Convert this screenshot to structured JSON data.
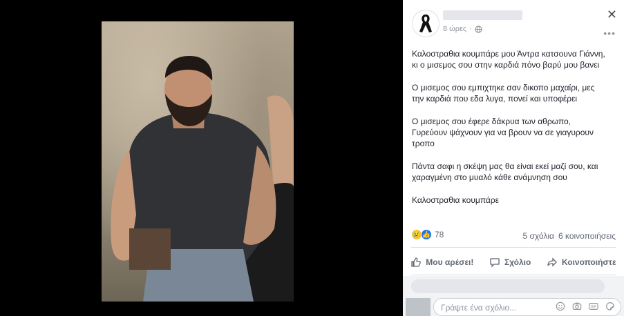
{
  "post": {
    "time": "8 ώρες",
    "paragraphs": [
      "Καλοστραθια κουμπάρε μου Άντρα κατσουνα Γιάννη,\nκι ο μισεμος σου στην καρδιά πόνο βαρύ μου βανει",
      "Ο μισεμος σου εμπιχτηκε σαν δικοπο μαχαίρι, μες\nτην καρδιά που εδα λυγα, πονεί και υποφέρει",
      "Ο μισεμος σου έφερε δάκρυα των αθρωπο,\nΓυρεύουν ψάχνουν για να βρουν να σε γιαγυρουν\nτροπο",
      "Πάντα σαφι η σκέψη μας θα είναι εκεί μαζί σου, και\nχαραγμένη στο μυαλό κάθε ανάμνηση σου",
      "Καλοστραθια κουμπάρε"
    ],
    "reaction_count": "78",
    "comments_count": "5 σχόλια",
    "shares_count": "6 κοινοποιήσεις"
  },
  "actions": {
    "like": "Μου αρέσει!",
    "comment": "Σχόλιο",
    "share": "Κοινοποιήστε"
  },
  "reply": {
    "placeholder": "Γράψτε ένα σχόλιο..."
  },
  "icons": {
    "avatar": "black-ribbon-icon",
    "privacy": "globe-icon",
    "close": "close-icon",
    "more": "more-icon"
  }
}
